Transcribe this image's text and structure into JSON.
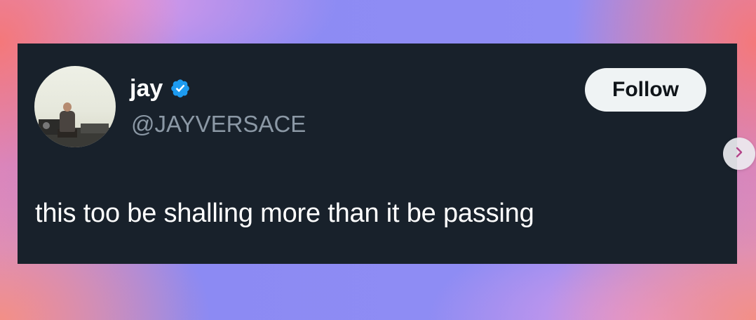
{
  "tweet": {
    "display_name": "jay",
    "handle": "@JAYVERSACE",
    "verified": true,
    "text": "this too be shalling more than it be passing",
    "follow_label": "Follow"
  },
  "colors": {
    "card_background": "#18212b",
    "verified_blue": "#1d9bf0",
    "handle_gray": "#8b98a5",
    "follow_button_bg": "#eff3f4"
  },
  "icons": {
    "verified": "verified-badge-icon",
    "next": "chevron-right-icon"
  }
}
